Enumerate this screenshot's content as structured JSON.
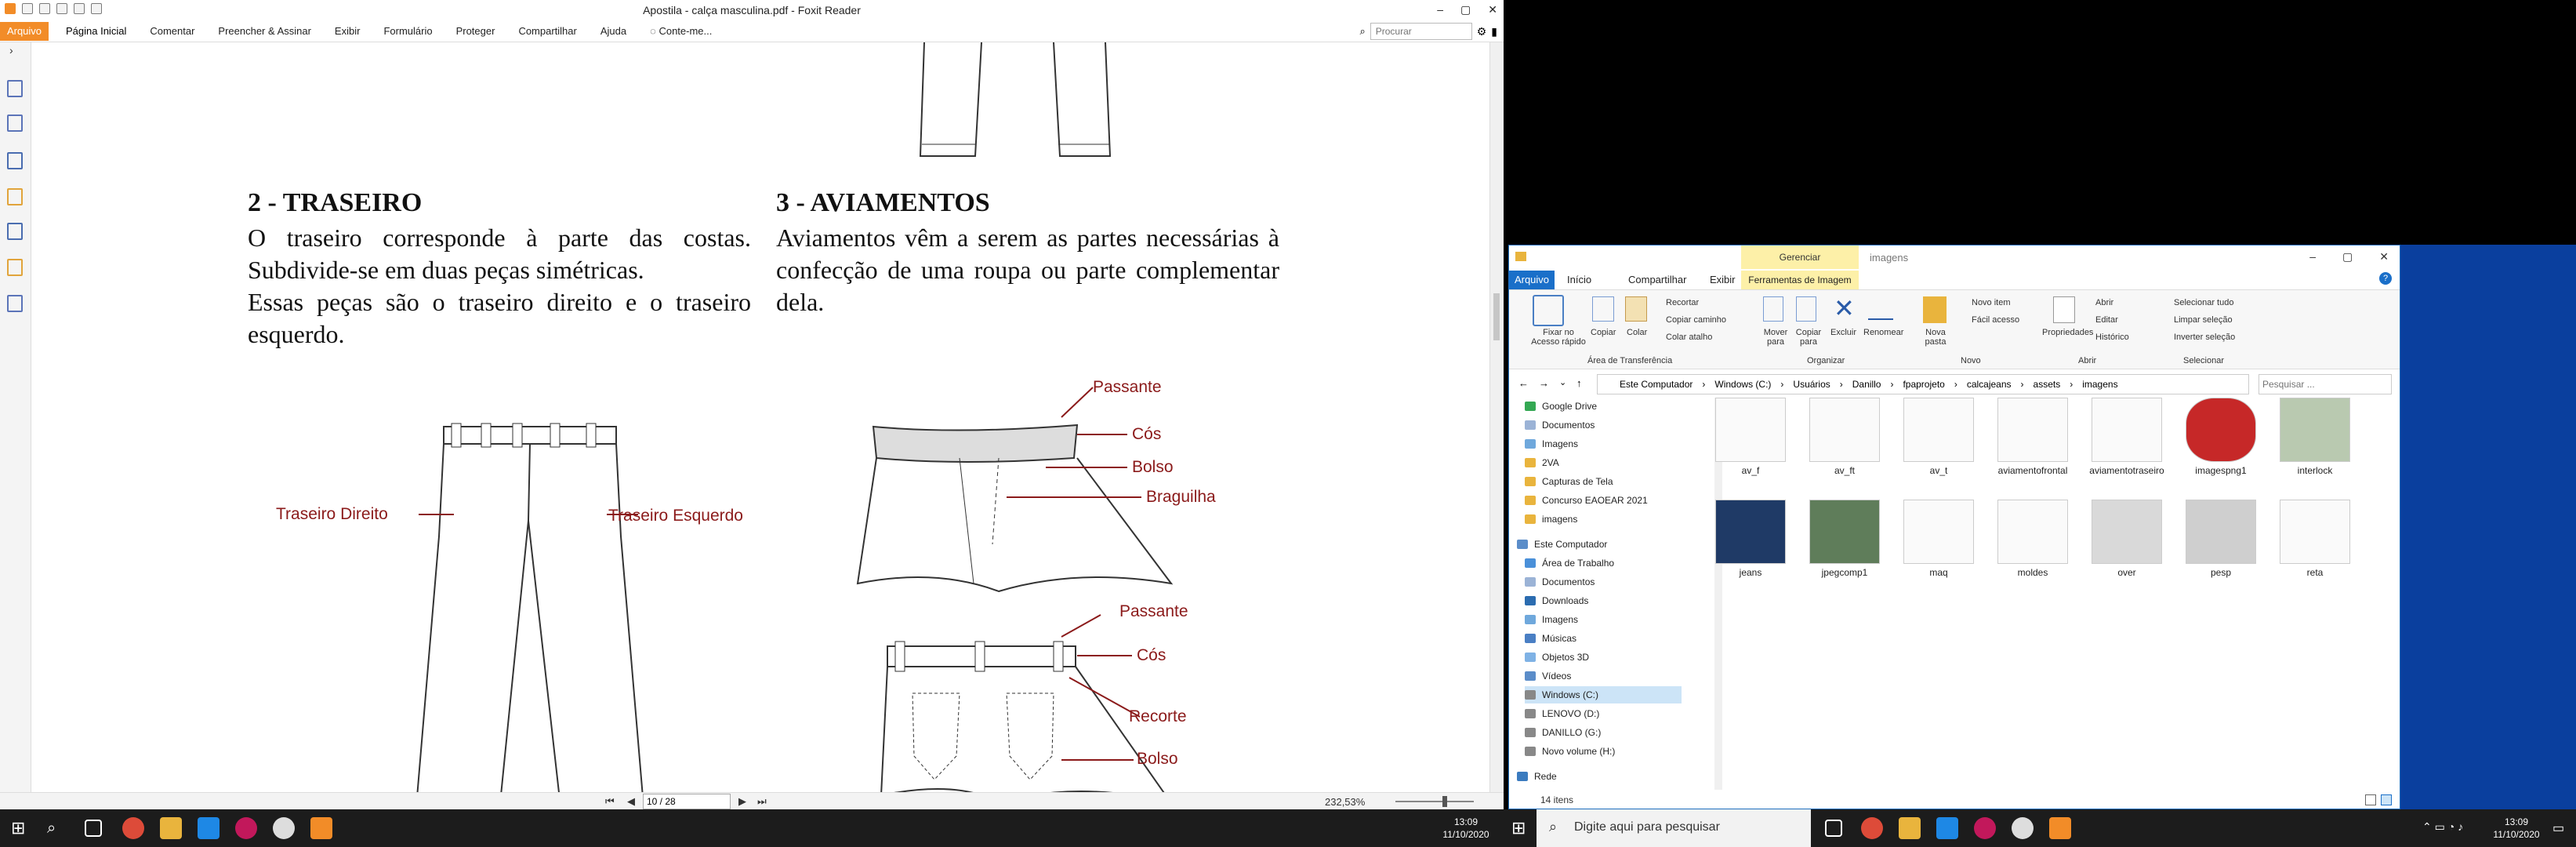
{
  "foxit": {
    "title": "Apostila - calça masculina.pdf - Foxit Reader",
    "file_tab": "Arquivo",
    "tabs": [
      "Página Inicial",
      "Comentar",
      "Preencher & Assinar",
      "Exibir",
      "Formulário",
      "Proteger",
      "Compartilhar",
      "Ajuda"
    ],
    "tell_me": "Conte-me...",
    "search_placeholder": "Procurar",
    "page_field": "10 / 28",
    "zoom": "232,53%",
    "doc": {
      "h2": "2 - TRASEIRO",
      "p2": "O traseiro corresponde à parte das costas. Subdivide-se em duas peças simétricas.",
      "p2b": "Essas peças são o traseiro direito e o traseiro esquerdo.",
      "h3": "3 - AVIAMENTOS",
      "p3": "Aviamentos vêm a serem as partes necessárias à confecção de uma roupa ou parte complementar dela.",
      "label_left": "Traseiro Direito",
      "label_right": "Traseiro Esquerdo",
      "labels_front": [
        "Passante",
        "Cós",
        "Bolso",
        "Braguilha"
      ],
      "labels_back": [
        "Passante",
        "Cós",
        "Recorte",
        "Bolso"
      ]
    }
  },
  "explorer": {
    "title": "imagens",
    "context_tab": "Gerenciar",
    "tabs": [
      "Arquivo",
      "Início",
      "Compartilhar",
      "Exibir",
      "Ferramentas de Imagem"
    ],
    "ribbon": {
      "pin": "Fixar no Acesso rápido",
      "copy": "Copiar",
      "paste": "Colar",
      "cut": "Recortar",
      "copy_path": "Copiar caminho",
      "paste_shortcut": "Colar atalho",
      "group_clipboard": "Área de Transferência",
      "move": "Mover para",
      "copy_to": "Copiar para",
      "delete": "Excluir",
      "rename": "Renomear",
      "group_organize": "Organizar",
      "new_folder": "Nova pasta",
      "new_item": "Novo item",
      "easy_access": "Fácil acesso",
      "group_new": "Novo",
      "properties": "Propriedades",
      "open": "Abrir",
      "edit": "Editar",
      "history": "Histórico",
      "group_open": "Abrir",
      "select_all": "Selecionar tudo",
      "select_none": "Limpar seleção",
      "invert": "Inverter seleção",
      "group_select": "Selecionar"
    },
    "path": [
      "Este Computador",
      "Windows (C:)",
      "Usuários",
      "Danillo",
      "fpaprojeto",
      "calcajeans",
      "assets",
      "imagens"
    ],
    "search_placeholder": "Pesquisar ...",
    "nav": [
      "Google Drive",
      "Documentos",
      "Imagens",
      "2VA",
      "Capturas de Tela",
      "Concurso EAOEAR 2021",
      "imagens",
      "Este Computador",
      "Área de Trabalho",
      "Documentos",
      "Downloads",
      "Imagens",
      "Músicas",
      "Objetos 3D",
      "Vídeos",
      "Windows (C:)",
      "LENOVO (D:)",
      "DANILLO (G:)",
      "Novo volume (H:)",
      "Rede"
    ],
    "files": [
      "av_f",
      "av_ft",
      "av_t",
      "aviamentofrontal",
      "aviamentotraseiro",
      "imagespng1",
      "interlock",
      "jeans",
      "jpegcomp1",
      "maq",
      "moldes",
      "over",
      "pesp",
      "reta"
    ],
    "status": "14 itens"
  },
  "taskbar": {
    "search_placeholder": "Digite aqui para pesquisar",
    "time": "13:09",
    "date": "11/10/2020"
  }
}
